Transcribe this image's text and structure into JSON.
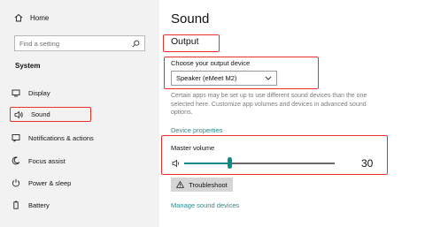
{
  "sidebar": {
    "home_label": "Home",
    "search_placeholder": "Find a setting",
    "section_label": "System",
    "items": [
      {
        "label": "Display",
        "icon": "display-icon"
      },
      {
        "label": "Sound",
        "icon": "speaker-icon",
        "active": true
      },
      {
        "label": "Notifications & actions",
        "icon": "notifications-icon"
      },
      {
        "label": "Focus assist",
        "icon": "focus-assist-icon"
      },
      {
        "label": "Power & sleep",
        "icon": "power-icon"
      },
      {
        "label": "Battery",
        "icon": "battery-icon"
      }
    ]
  },
  "main": {
    "title": "Sound",
    "output_heading": "Output",
    "choose_label": "Choose your output device",
    "selected_device": "Speaker (eMeet M2)",
    "description": "Certain apps may be set up to use different sound devices than the one selected here. Customize app volumes and devices in advanced sound options.",
    "device_properties_link": "Device properties",
    "master_volume_label": "Master volume",
    "volume_value": "30",
    "volume_level": 0.3,
    "troubleshoot_label": "Troubleshoot",
    "manage_devices_link": "Manage sound devices"
  },
  "colors": {
    "accent": "#0c8a8a",
    "link": "#2b8a8a",
    "highlight_box": "#e8302c",
    "sidebar_bg": "#f2f2f2"
  }
}
